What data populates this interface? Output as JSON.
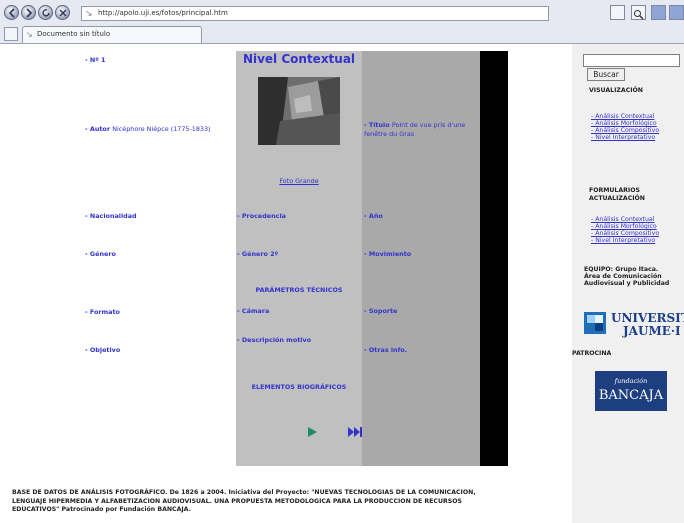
{
  "browser": {
    "url": "http://apolo.uji.es/fotos/principal.htm",
    "tab_title": "Documento sin título"
  },
  "nivel": {
    "title": "Nivel Contextual",
    "foto_link": "Foto Grande"
  },
  "fields": {
    "num": "- Nº 1",
    "autor_label": "- Autor",
    "autor_value": "Nicéphore Niépce (1775-1833)",
    "titulo_label": "- Título",
    "titulo_value_1": "Point de vue pris d'une",
    "titulo_value_2": "fenêtre du Gras",
    "nacionalidad": "- Nacionalidad",
    "procedencia": "- Procedencia",
    "ano": "- Año",
    "genero": "- Género",
    "genero2": "- Género 2º",
    "movimiento": "- Movimiento",
    "parametros": "PARÁMETROS TÉCNICOS",
    "formato": "- Formato",
    "camara": "- Cámara",
    "soporte": "- Soporte",
    "objetivo": "- Objetivo",
    "descripcion": "- Descripción motivo",
    "otras": "- Otras info.",
    "elementos": "ELEMENTOS BIOGRÁFICOS"
  },
  "footer": {
    "line1": "BASE DE DATOS DE ANÁLISIS FOTOGRÁFICO. De 1826 a 2004. Iniciativa del Proyecto: \"NUEVAS TECNOLOGIAS DE LA COMUNICACION,",
    "line2": "LENGUAJE HIPERMEDIA Y ALFABETIZACION AUDIOVISUAL. UNA PROPUESTA METODOLOGICA PARA LA PRODUCCION DE RECURSOS",
    "line3": "EDUCATIVOS\" Patrocinado por Fundación BANCAJA."
  },
  "sidebar": {
    "search_button": "Buscar",
    "visualizacion_head": "VISUALIZACIÓN",
    "vis_links": [
      "- Análisis Contextual",
      "- Análisis Morfológico",
      "- Análisis Compositivo",
      "- Nivel Interpretativo"
    ],
    "formularios_head_1": "FORMULARIOS",
    "formularios_head_2": "ACTUALIZACIÓN",
    "form_links": [
      "- Análisis Contextual",
      "- Análisis Morfológico",
      "- Análisis Compositivo",
      "- Nivel Interpretativo"
    ],
    "equipo_1": "EQUIPO: Grupo Itaca.",
    "equipo_2": "Área de Comunicación",
    "equipo_3": "Audiovisual y Publicidad",
    "uji_1": "UNIVERSITAT",
    "uji_2": "JAUME·I",
    "patrocina": "PATROCINA",
    "bancaja_1": "fundación",
    "bancaja_2": "BANCAJA"
  }
}
